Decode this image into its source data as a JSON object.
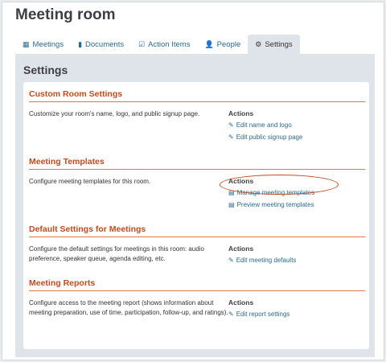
{
  "app": {
    "title": "Meeting room"
  },
  "tabs": [
    {
      "icon": "grid-icon",
      "glyph": "▦",
      "label": "Meetings",
      "active": false
    },
    {
      "icon": "document-icon",
      "glyph": "▮",
      "label": "Documents",
      "active": false
    },
    {
      "icon": "checkbox-icon",
      "glyph": "☑",
      "label": "Action Items",
      "active": false
    },
    {
      "icon": "user-icon",
      "glyph": "👤",
      "label": "People",
      "active": false
    },
    {
      "icon": "gear-icon",
      "glyph": "⚙",
      "label": "Settings",
      "active": true
    }
  ],
  "settings": {
    "title": "Settings",
    "actions_label": "Actions",
    "sections": [
      {
        "title": "Custom Room Settings",
        "description": "Customize your room's name, logo, and public signup page.",
        "links": [
          {
            "icon": "pencil-icon",
            "glyph": "✎",
            "label": "Edit name and logo"
          },
          {
            "icon": "pencil-icon",
            "glyph": "✎",
            "label": "Edit public signup page"
          }
        ]
      },
      {
        "title": "Meeting Templates",
        "description": "Configure meeting templates for this room.",
        "links": [
          {
            "icon": "image-icon",
            "glyph": "▤",
            "label": "Manage meeting templates"
          },
          {
            "icon": "image-icon",
            "glyph": "▤",
            "label": "Preview meeting templates"
          }
        ]
      },
      {
        "title": "Default Settings for Meetings",
        "description": "Configure the default settings for meetings in this room: audio preference, speaker queue, agenda editing, etc.",
        "links": [
          {
            "icon": "pencil-icon",
            "glyph": "✎",
            "label": "Edit meeting defaults"
          }
        ]
      },
      {
        "title": "Meeting Reports",
        "description": "Configure access to the meeting report (shows information about meeting preparation, use of time, participation, follow-up, and ratings).",
        "links": [
          {
            "icon": "pencil-icon",
            "glyph": "✎",
            "label": "Edit report settings"
          }
        ]
      }
    ]
  },
  "colors": {
    "section_heading": "#c44a1c",
    "link": "#2b6a8e",
    "panel_bg": "#dfe4ea",
    "highlight_oval": "#c44a1c"
  }
}
